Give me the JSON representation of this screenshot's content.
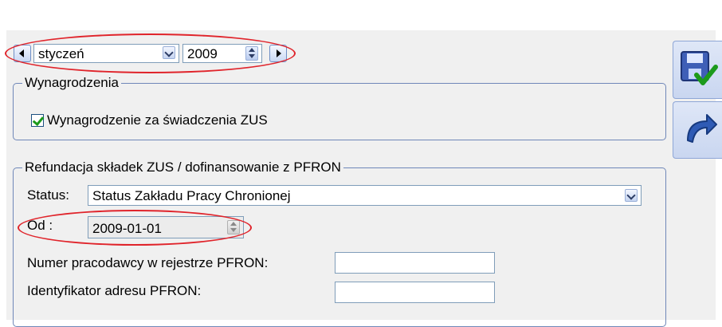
{
  "period": {
    "month_value": "styczeń",
    "year_value": "2009"
  },
  "wynagrodzenia": {
    "title": "Wynagrodzenia",
    "checkbox_label": "Wynagrodzenie za świadczenia ZUS",
    "checkbox_checked": true
  },
  "refundacja": {
    "title": "Refundacja składek ZUS / dofinansowanie z PFRON",
    "status_label": "Status:",
    "status_value": "Status Zakładu Pracy Chronionej",
    "od_label": "Od :",
    "od_value": "2009-01-01",
    "numer_label": "Numer pracodawcy w rejestrze PFRON:",
    "numer_value": "",
    "identyfikator_label": "Identyfikator adresu PFRON:",
    "identyfikator_value": ""
  },
  "colors": {
    "highlight_ellipse": "#e0242b",
    "group_border": "#6f87b8",
    "check_green": "#1c9a1c"
  },
  "icons": {
    "save": "floppy-disk-check-icon",
    "undo": "undo-arrow-icon"
  }
}
